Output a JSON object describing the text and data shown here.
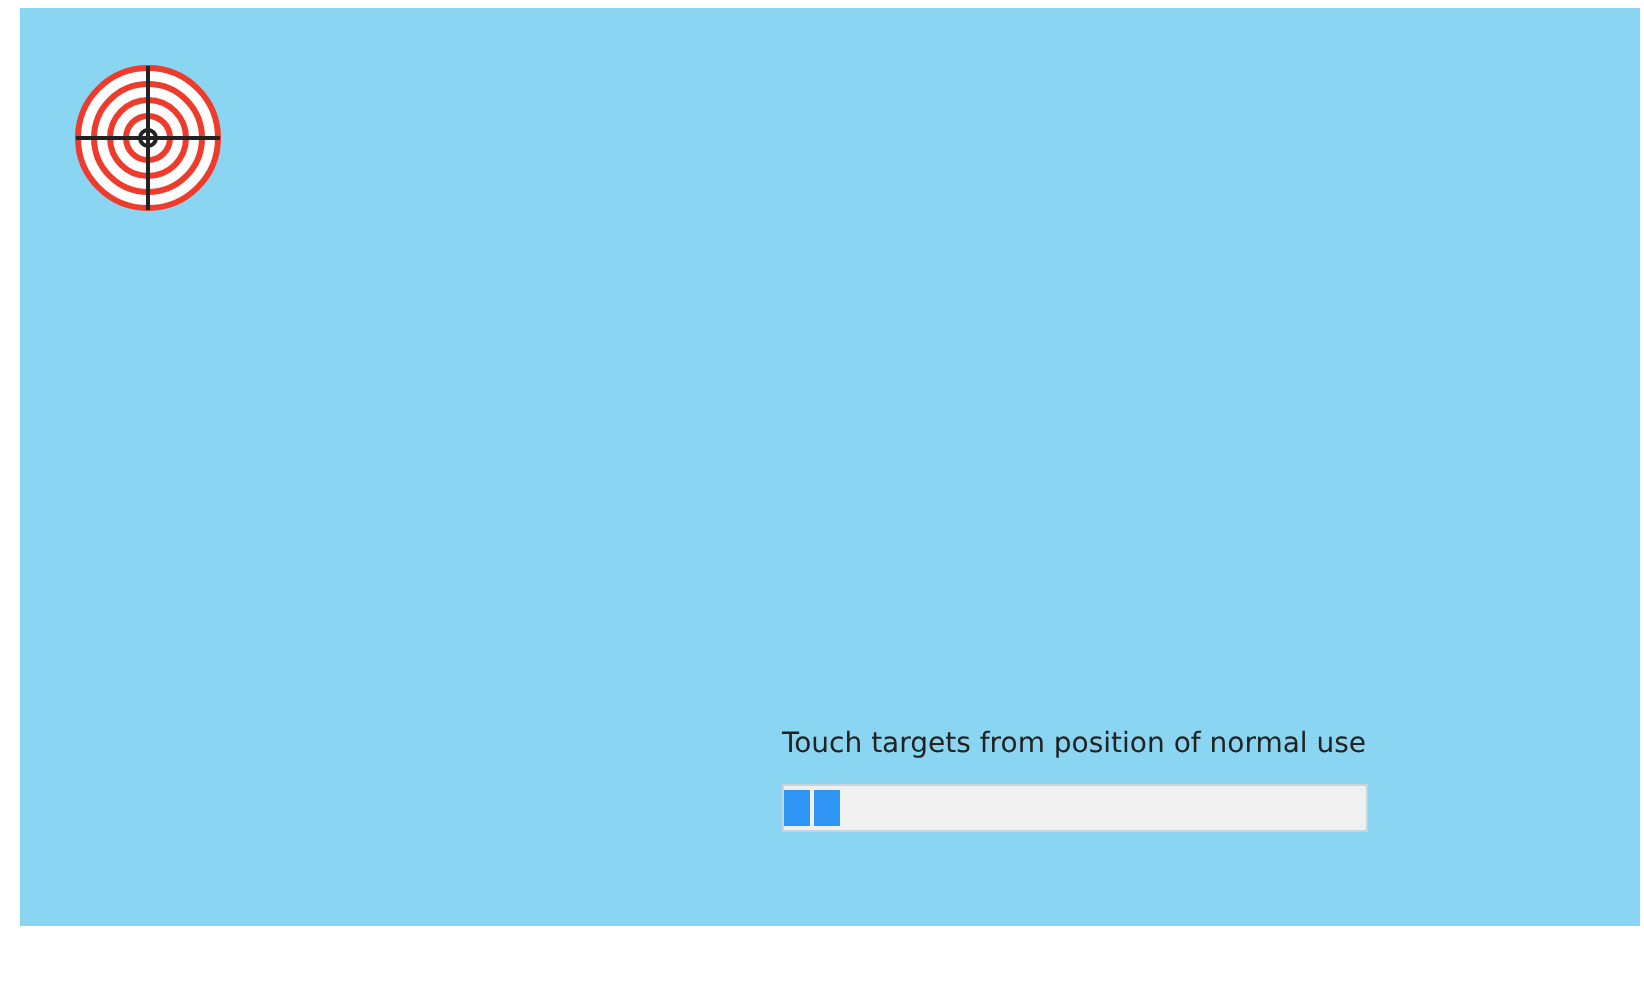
{
  "instruction": "Touch targets from position of normal use",
  "progress": {
    "level": 0.1
  }
}
